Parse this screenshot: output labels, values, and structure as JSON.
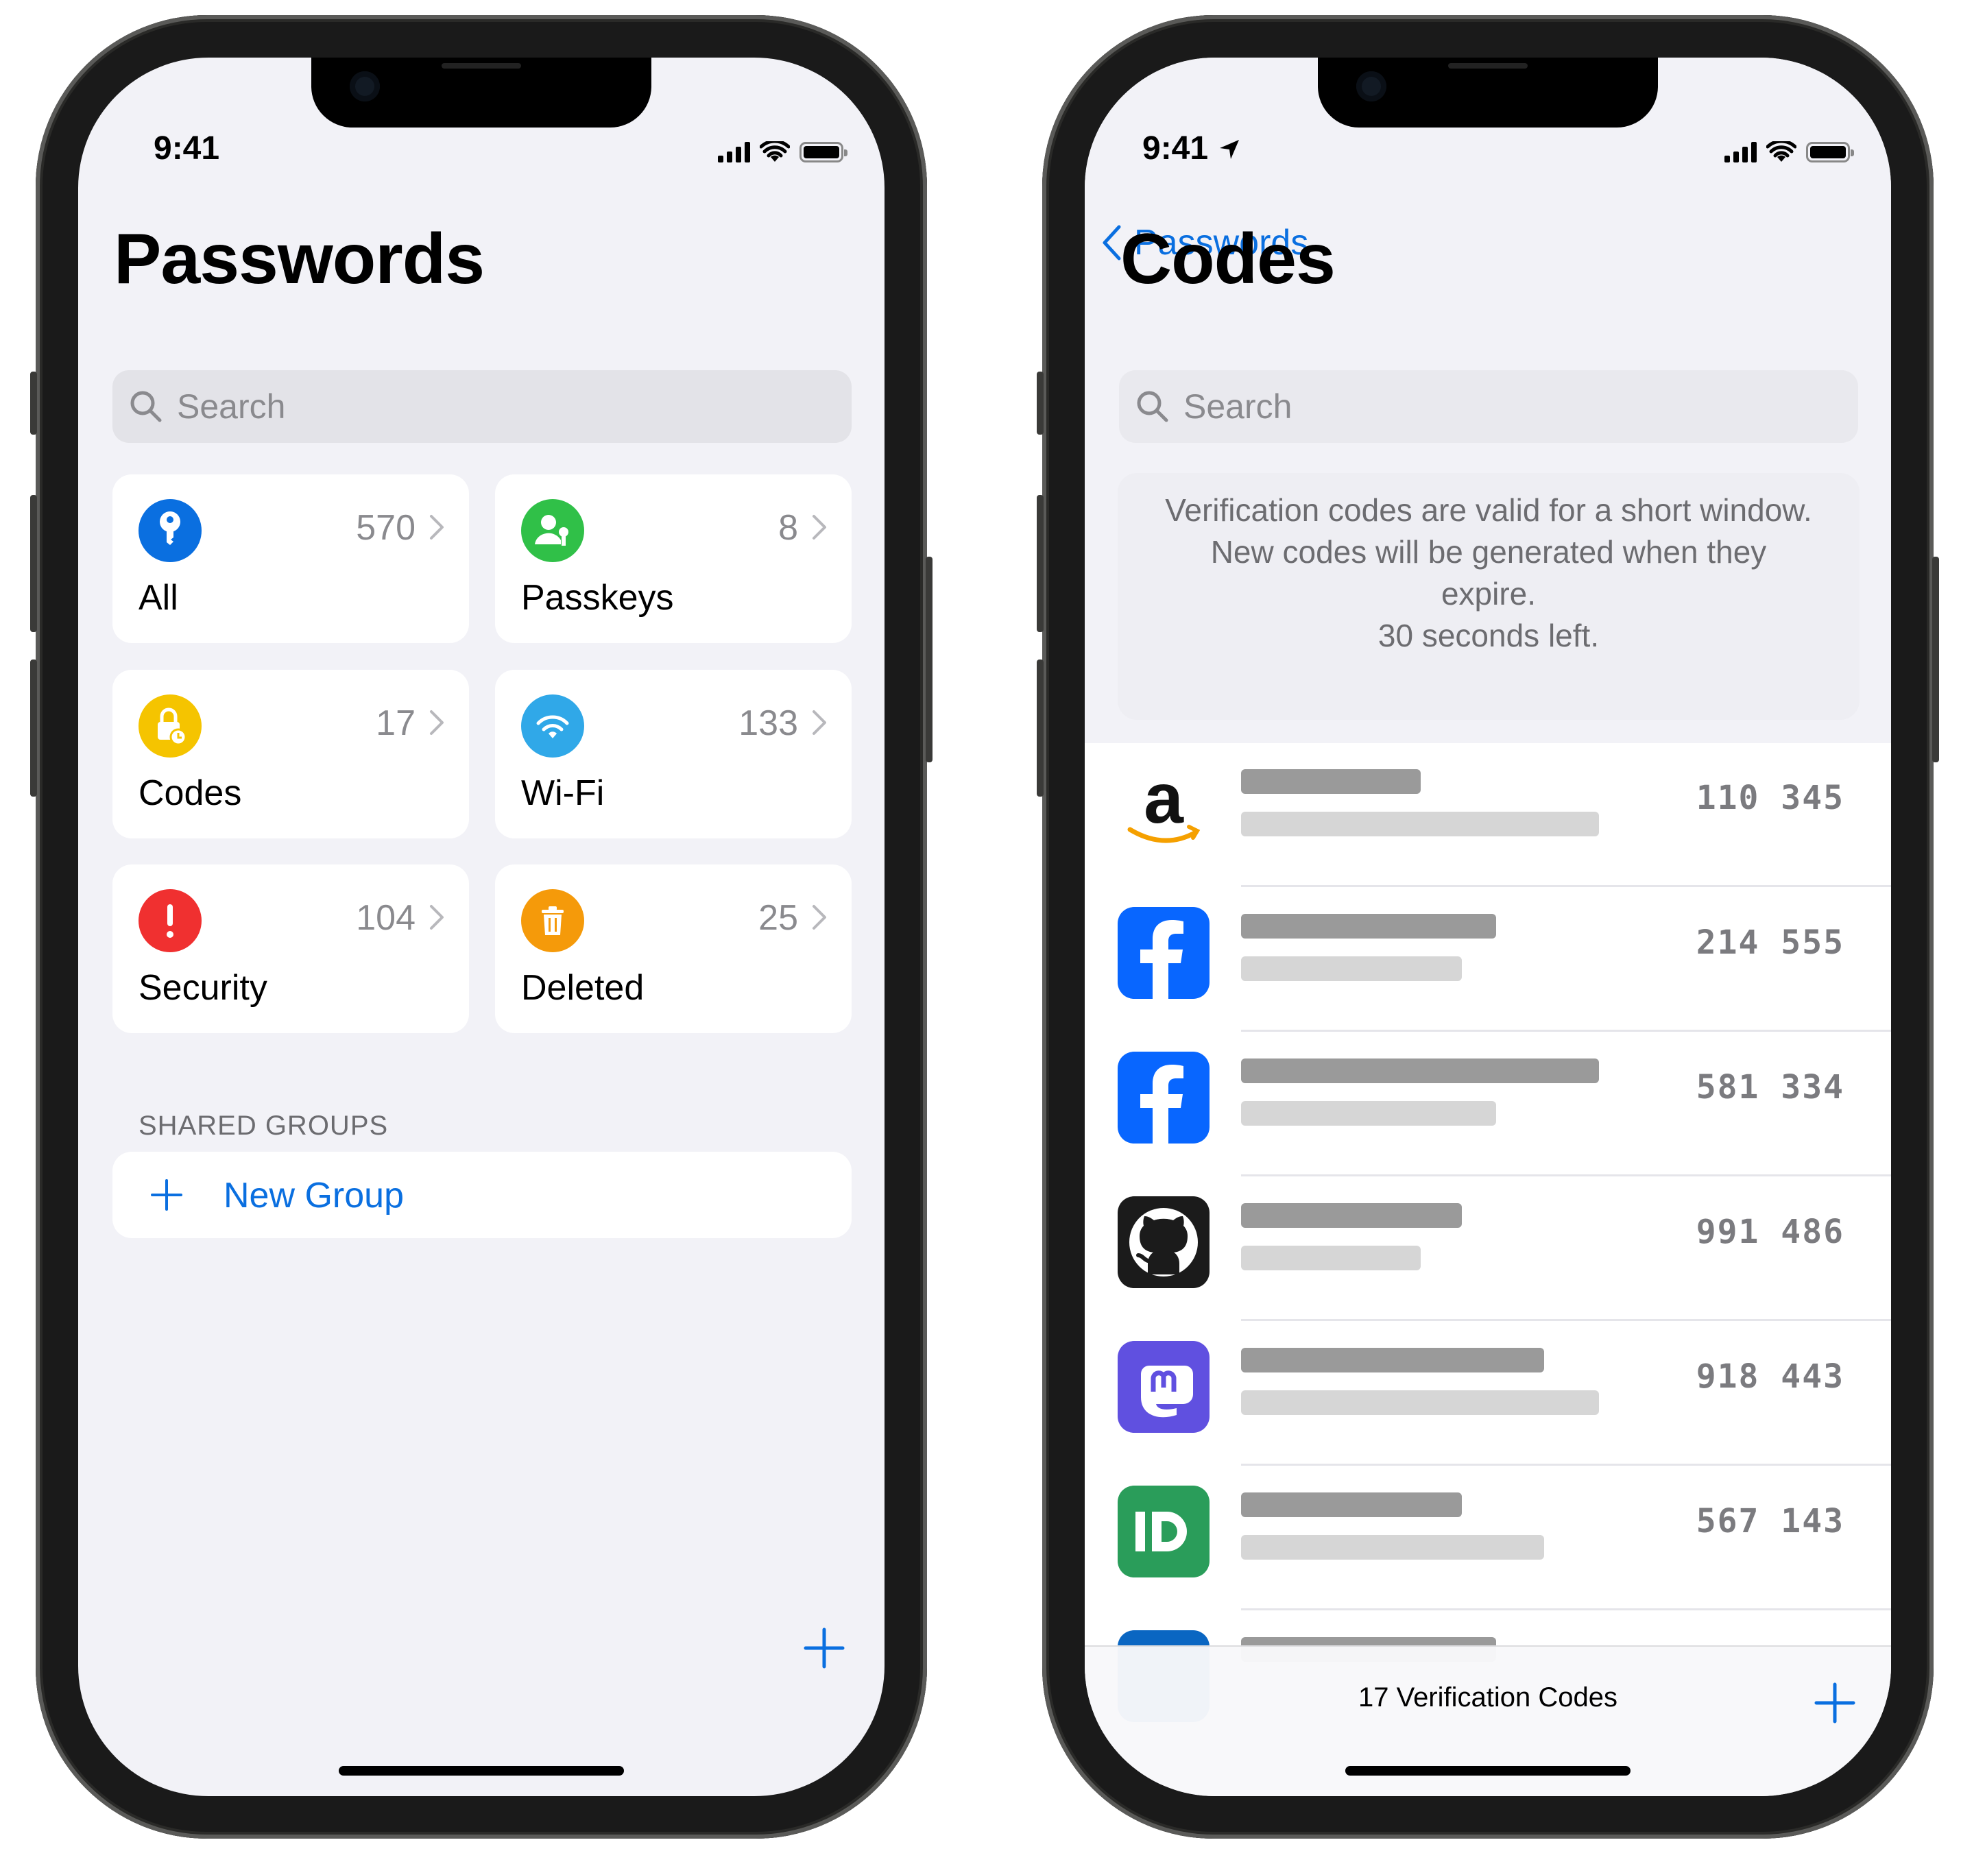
{
  "left": {
    "status_time": "9:41",
    "title": "Passwords",
    "search_placeholder": "Search",
    "categories": [
      {
        "label": "All",
        "count": "570",
        "icon": "key-icon",
        "color": "#0a6fe0"
      },
      {
        "label": "Passkeys",
        "count": "8",
        "icon": "person-key-icon",
        "color": "#30c048"
      },
      {
        "label": "Codes",
        "count": "17",
        "icon": "lock-clock-icon",
        "color": "#f5c400"
      },
      {
        "label": "Wi-Fi",
        "count": "133",
        "icon": "wifi-icon",
        "color": "#30a8e8"
      },
      {
        "label": "Security",
        "count": "104",
        "icon": "exclamation-icon",
        "color": "#f03030"
      },
      {
        "label": "Deleted",
        "count": "25",
        "icon": "trash-icon",
        "color": "#f59a0a"
      }
    ],
    "shared_groups_header": "SHARED GROUPS",
    "new_group_label": "New Group"
  },
  "right": {
    "status_time": "9:41",
    "back_label": "Passwords",
    "title": "Codes",
    "search_placeholder": "Search",
    "notice_lines": [
      "Verification codes are valid for a short window.",
      "New codes will be generated when they",
      "expire.",
      "30 seconds left."
    ],
    "codes": [
      {
        "service_icon": "amazon-logo",
        "code": "110 345"
      },
      {
        "service_icon": "facebook-logo",
        "code": "214 555"
      },
      {
        "service_icon": "facebook-logo",
        "code": "581 334"
      },
      {
        "service_icon": "github-logo",
        "code": "991 486"
      },
      {
        "service_icon": "mastodon-logo",
        "code": "918 443"
      },
      {
        "service_icon": "id-me-logo",
        "code": "567 143"
      }
    ],
    "footer_label": "17 Verification Codes"
  },
  "colors": {
    "accent": "#0a6fe0",
    "background": "#f2f2f7"
  }
}
